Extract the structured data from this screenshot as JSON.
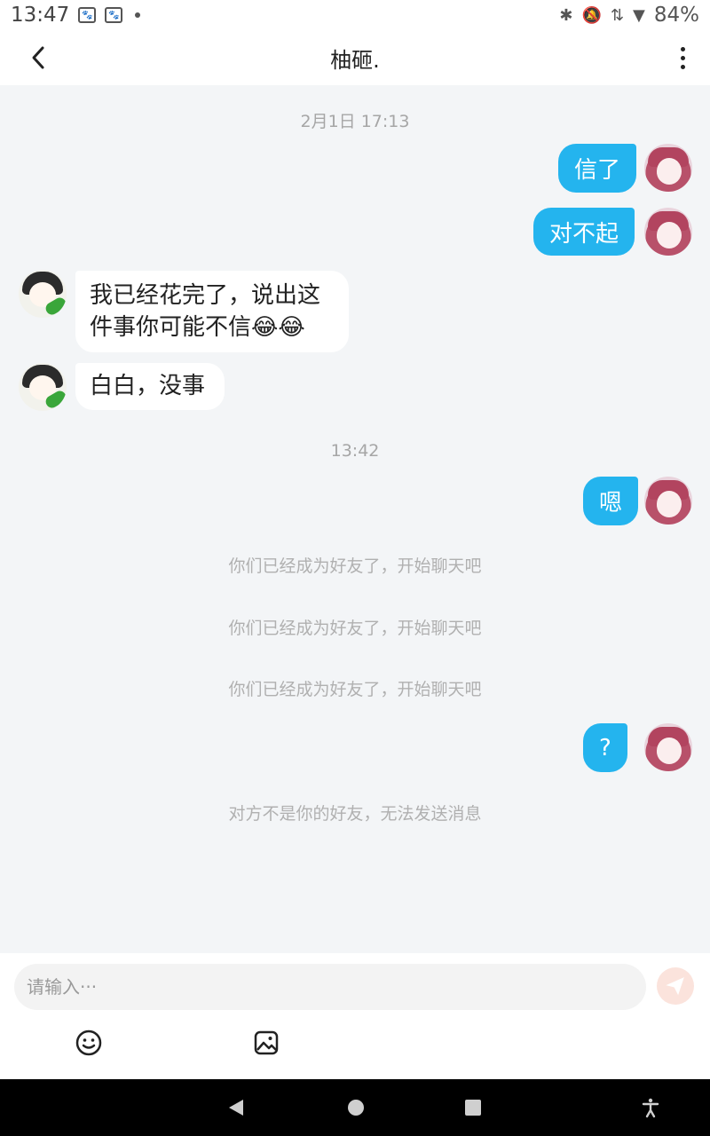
{
  "status_bar": {
    "time": "13:47",
    "icons": [
      "paw-icon",
      "paw-icon",
      "dot-icon",
      "bluetooth-icon",
      "mute-icon",
      "data-arrows-icon",
      "wifi-icon"
    ],
    "battery": "84%"
  },
  "header": {
    "title": "柚砸."
  },
  "messages": {
    "time1": "2月1日 17:13",
    "m1": "信了",
    "m2": "对不起",
    "m3_line1": "我已经花完了，说出这",
    "m3_line2": "件事你可能不信",
    "m3_emoji": "😂😂",
    "m4": "白白，没事",
    "time2": "13:42",
    "m5": "嗯",
    "sys1": "你们已经成为好友了，开始聊天吧",
    "sys2": "你们已经成为好友了，开始聊天吧",
    "sys3": "你们已经成为好友了，开始聊天吧",
    "m6": "?",
    "sys4": "对方不是你的好友，无法发送消息"
  },
  "input": {
    "placeholder": "请输入···",
    "value": ""
  },
  "colors": {
    "my_bubble": "#24b4ee",
    "background": "#f3f5f7",
    "send_button": "#fbe3dc"
  }
}
